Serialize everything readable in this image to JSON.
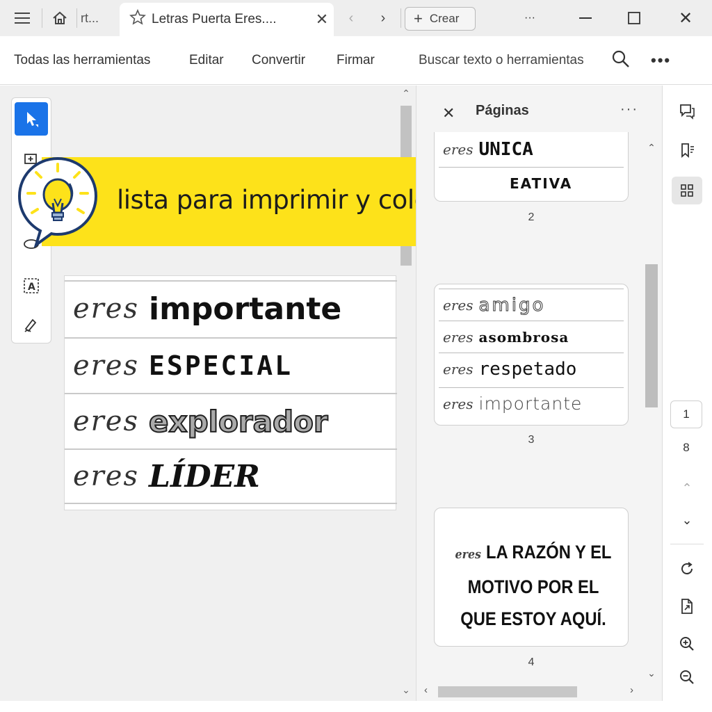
{
  "titlebar": {
    "inactive_tab_label": "rt...",
    "active_tab_title": "Letras Puerta Eres....",
    "create_label": "Crear",
    "menu_dots": "···"
  },
  "menubar": {
    "items": [
      "Todas las herramientas",
      "Editar",
      "Convertir",
      "Firmar"
    ],
    "search_label": "Buscar texto o herramientas",
    "more": "•••"
  },
  "banner": {
    "text": "lista para imprimir y colocar",
    "color": "#fde21a"
  },
  "document": {
    "rows": [
      {
        "prefix": "eres",
        "word": "importante"
      },
      {
        "prefix": "eres",
        "word": "ESPECIAL"
      },
      {
        "prefix": "eres",
        "word": "explorador"
      },
      {
        "prefix": "eres",
        "word": "LÍDER"
      }
    ]
  },
  "pages_panel": {
    "title": "Páginas",
    "more": "···",
    "page2": {
      "rows": [
        {
          "prefix": "eres",
          "word": "UNICA"
        },
        {
          "prefix": "",
          "word": "EATIVA"
        }
      ],
      "number": "2"
    },
    "page3": {
      "rows": [
        {
          "prefix": "eres",
          "word": "amigo"
        },
        {
          "prefix": "eres",
          "word": "asombrosa"
        },
        {
          "prefix": "eres",
          "word": "respetado"
        },
        {
          "prefix": "eres",
          "word": "importante"
        }
      ],
      "number": "3"
    },
    "page4": {
      "prefix": "eres",
      "lines": [
        "LA RAZÓN Y EL",
        "MOTIVO POR EL",
        "QUE ESTOY AQUÍ."
      ],
      "number": "4"
    }
  },
  "right_rail": {
    "current_page": "1",
    "total_pages": "8"
  },
  "colors": {
    "accent": "#1a73e8",
    "banner": "#fde21a"
  }
}
